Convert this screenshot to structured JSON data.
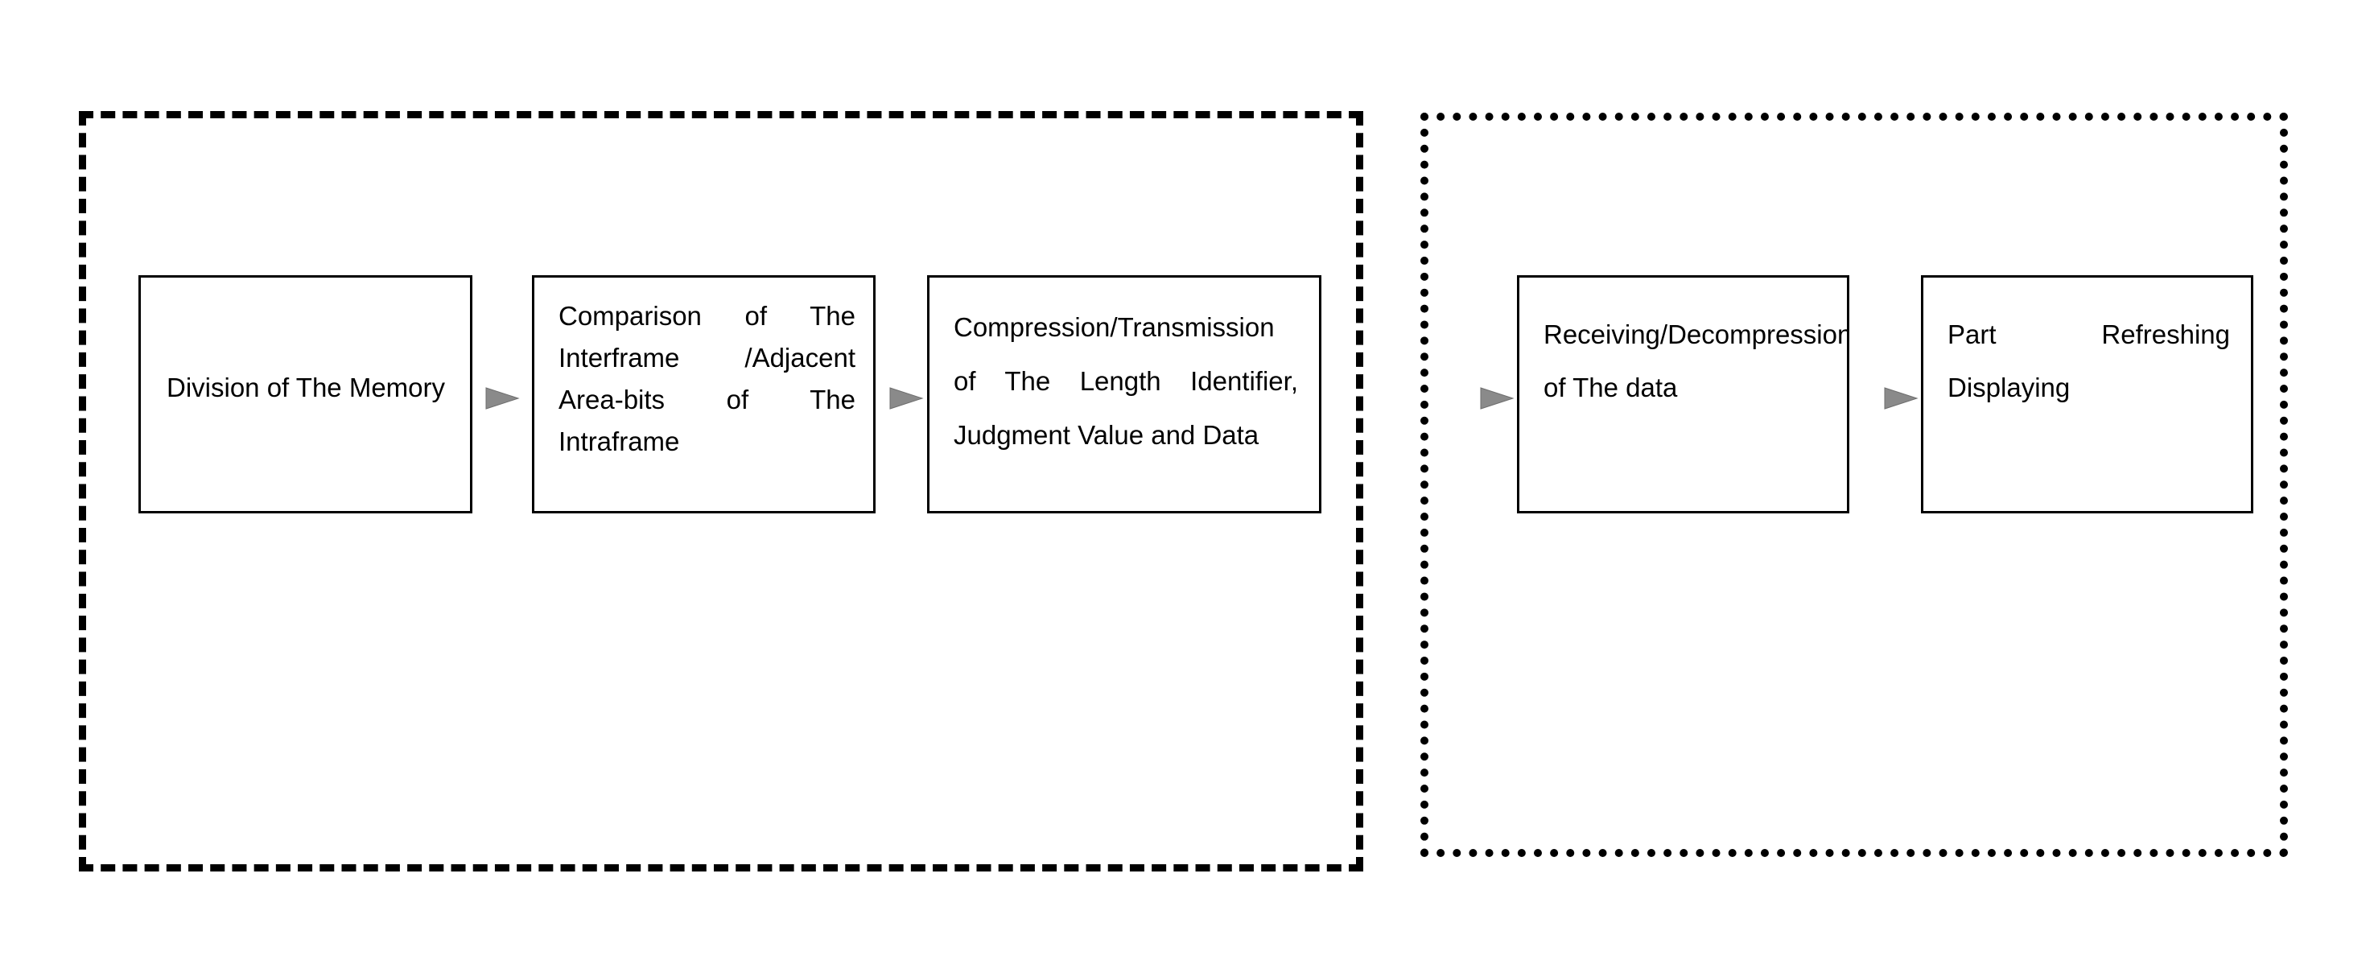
{
  "diagram": {
    "type": "flow",
    "title": "",
    "background_color": "#ffffff",
    "line_color": "#000000",
    "arrow_color": "#777777",
    "groups": [
      {
        "id": "transmitter-group",
        "border_style": "dashed",
        "label": ""
      },
      {
        "id": "receiver-group",
        "border_style": "dotted",
        "label": ""
      }
    ],
    "nodes": [
      {
        "id": "node-1",
        "group": "transmitter-group",
        "text": "Division of The Memory"
      },
      {
        "id": "node-2",
        "group": "transmitter-group",
        "text": "Comparison of The Interframe /Adjacent Area-bits of The Intraframe"
      },
      {
        "id": "node-3",
        "group": "transmitter-group",
        "text": "Compression/Transmission of The Length Identifier, Judgment Value and Data"
      },
      {
        "id": "node-4",
        "group": "receiver-group",
        "text": "Receiving/Decompression of The data"
      },
      {
        "id": "node-5",
        "group": "receiver-group",
        "text": "Part Refreshing Displaying"
      }
    ],
    "arrows": [
      {
        "id": "arrow-1",
        "from": "node-1",
        "to": "node-2",
        "icon": "arrow-right-icon"
      },
      {
        "id": "arrow-2",
        "from": "node-2",
        "to": "node-3",
        "icon": "arrow-right-icon"
      },
      {
        "id": "arrow-3",
        "from": "node-3",
        "to": "node-4",
        "icon": "arrow-right-icon"
      },
      {
        "id": "arrow-4",
        "from": "node-4",
        "to": "node-5",
        "icon": "arrow-right-icon"
      }
    ]
  }
}
